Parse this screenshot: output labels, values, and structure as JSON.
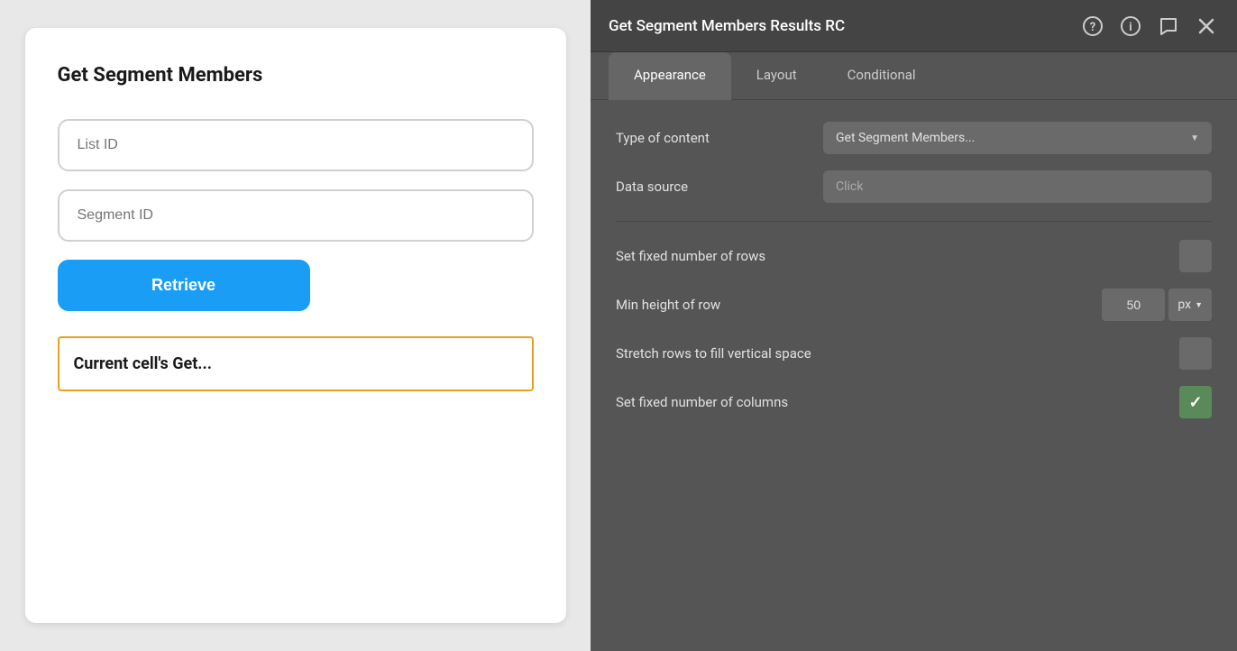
{
  "left": {
    "title": "Get Segment Members",
    "list_id_placeholder": "List ID",
    "segment_id_placeholder": "Segment ID",
    "retrieve_button": "Retrieve",
    "current_cell_text": "Current cell's Get..."
  },
  "right": {
    "panel_title": "Get Segment Members Results RC",
    "icons": {
      "question": "?",
      "info": "i",
      "comment": "💬",
      "close": "✕"
    },
    "tabs": [
      {
        "label": "Appearance",
        "active": true
      },
      {
        "label": "Layout",
        "active": false
      },
      {
        "label": "Conditional",
        "active": false
      }
    ],
    "appearance": {
      "type_of_content_label": "Type of content",
      "type_of_content_value": "Get Segment Members...",
      "data_source_label": "Data source",
      "data_source_placeholder": "Click",
      "set_fixed_rows_label": "Set fixed number of rows",
      "set_fixed_rows_checked": false,
      "min_height_label": "Min height of row",
      "min_height_value": "50",
      "min_height_unit": "px",
      "stretch_rows_label": "Stretch rows to fill vertical space",
      "stretch_rows_checked": false,
      "set_fixed_columns_label": "Set fixed number of columns",
      "set_fixed_columns_checked": true
    }
  }
}
